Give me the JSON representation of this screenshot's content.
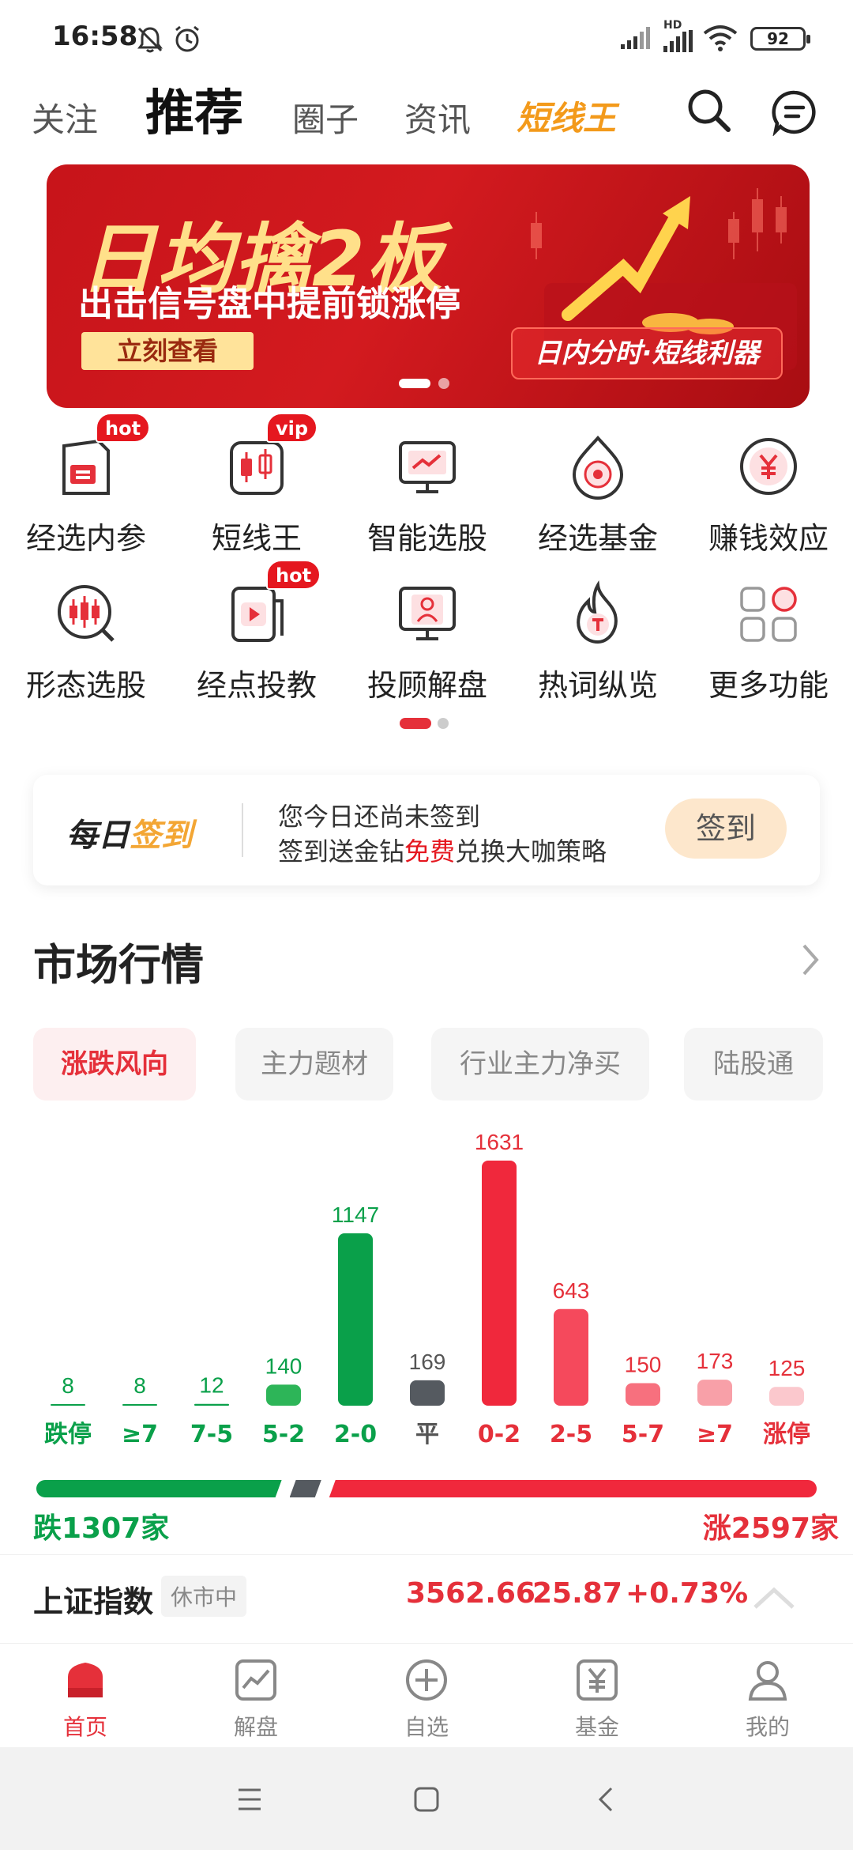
{
  "status_bar": {
    "time": "16:58",
    "battery": "92",
    "network_label": "HD"
  },
  "header": {
    "tabs": [
      {
        "label": "关注"
      },
      {
        "label": "推荐"
      },
      {
        "label": "圈子"
      },
      {
        "label": "资讯"
      },
      {
        "label": "短线王"
      }
    ],
    "search_icon": "search-icon",
    "message_icon": "message-icon"
  },
  "banner": {
    "title": "日均擒2板",
    "subtitle": "出击信号盘中提前锁涨停",
    "button": "立刻查看",
    "tag": "日内分时·短线利器"
  },
  "features": [
    {
      "label": "经选内参",
      "badge": "hot",
      "icon": "document-icon"
    },
    {
      "label": "短线王",
      "badge": "vip",
      "icon": "candlestick-icon"
    },
    {
      "label": "智能选股",
      "badge": "",
      "icon": "monitor-chart-icon"
    },
    {
      "label": "经选基金",
      "badge": "",
      "icon": "fund-drop-icon"
    },
    {
      "label": "赚钱效应",
      "badge": "",
      "icon": "yen-circle-icon"
    },
    {
      "label": "形态选股",
      "badge": "",
      "icon": "candle-search-icon"
    },
    {
      "label": "经点投教",
      "badge": "hot",
      "icon": "video-icon"
    },
    {
      "label": "投顾解盘",
      "badge": "",
      "icon": "advisor-screen-icon"
    },
    {
      "label": "热词纵览",
      "badge": "",
      "icon": "flame-icon"
    },
    {
      "label": "更多功能",
      "badge": "",
      "icon": "grid-more-icon"
    }
  ],
  "checkin": {
    "title_a": "每日",
    "title_b": "签到",
    "line1": "您今日还尚未签到",
    "line2_a": "签到送金钻",
    "line2_b": "免费",
    "line2_c": "兑换大咖策略",
    "button": "签到"
  },
  "market": {
    "title": "市场行情",
    "pills": [
      "涨跌风向",
      "主力题材",
      "行业主力净买",
      "陆股通"
    ],
    "fall_summary": "跌1307家",
    "rise_summary": "涨2597家"
  },
  "chart_data": {
    "type": "bar",
    "categories": [
      "跌停",
      "≥7",
      "7-5",
      "5-2",
      "2-0",
      "平",
      "0-2",
      "2-5",
      "5-7",
      "≥7",
      "涨停"
    ],
    "values": [
      8,
      8,
      12,
      140,
      1147,
      169,
      1631,
      643,
      150,
      173,
      125
    ],
    "colors": [
      "#0aa04a",
      "#0aa04a",
      "#0aa04a",
      "#2db558",
      "#0aa04a",
      "#555a60",
      "#f0283c",
      "#f5495c",
      "#f7707e",
      "#f8a0a8",
      "#fbc8cd"
    ],
    "label_colors": [
      "#0aa04a",
      "#0aa04a",
      "#0aa04a",
      "#0aa04a",
      "#0aa04a",
      "#555",
      "#e5303a",
      "#e5303a",
      "#e5303a",
      "#e5303a",
      "#e5303a"
    ],
    "split": {
      "fall": 1307,
      "flat": 169,
      "rise": 2597
    }
  },
  "index": {
    "name": "上证指数",
    "status": "休市中",
    "value": "3562.66",
    "change": "25.87",
    "percent": "+0.73%"
  },
  "nav": [
    {
      "label": "首页",
      "icon": "home-icon",
      "active": true
    },
    {
      "label": "解盘",
      "icon": "chart-icon",
      "active": false
    },
    {
      "label": "自选",
      "icon": "add-circle-icon",
      "active": false
    },
    {
      "label": "基金",
      "icon": "fund-icon",
      "active": false
    },
    {
      "label": "我的",
      "icon": "user-icon",
      "active": false
    }
  ]
}
